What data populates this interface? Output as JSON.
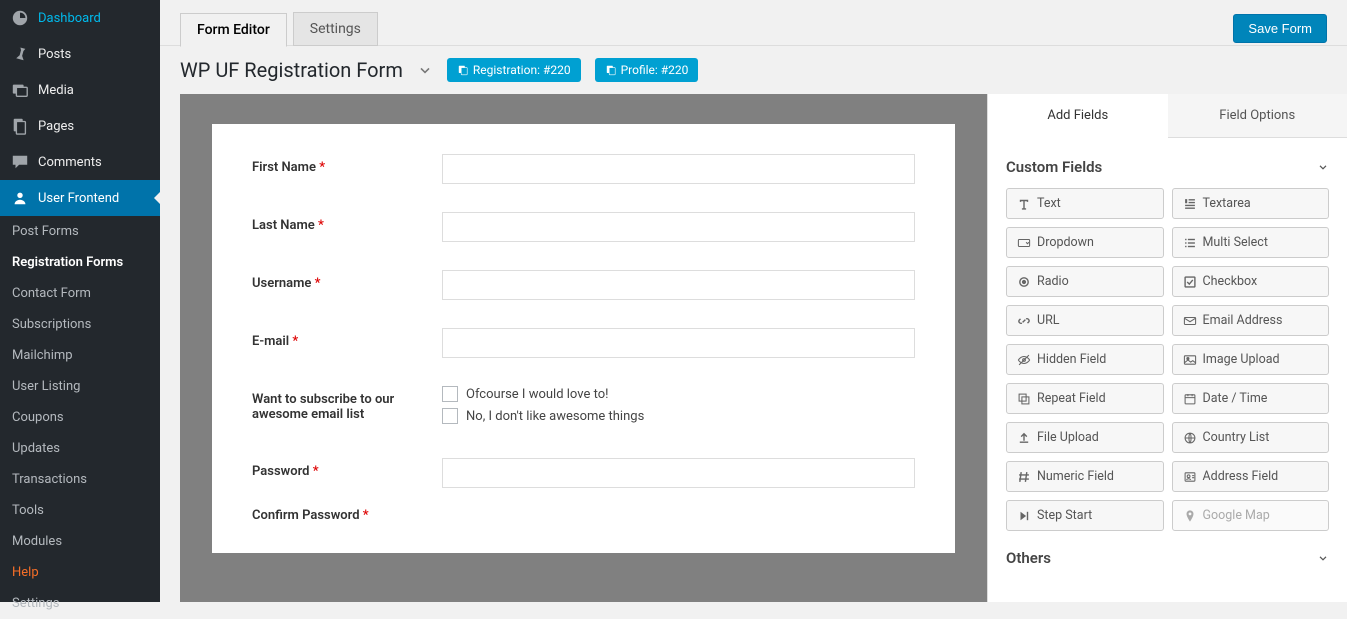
{
  "sidebar": {
    "items": [
      {
        "label": "Dashboard",
        "icon": "dashboard"
      },
      {
        "label": "Posts",
        "icon": "pin"
      },
      {
        "label": "Media",
        "icon": "media"
      },
      {
        "label": "Pages",
        "icon": "pages"
      },
      {
        "label": "Comments",
        "icon": "comments"
      },
      {
        "label": "User Frontend",
        "icon": "uf"
      }
    ],
    "sub": [
      {
        "label": "Post Forms"
      },
      {
        "label": "Registration Forms"
      },
      {
        "label": "Contact Form"
      },
      {
        "label": "Subscriptions"
      },
      {
        "label": "Mailchimp"
      },
      {
        "label": "User Listing"
      },
      {
        "label": "Coupons"
      },
      {
        "label": "Updates"
      },
      {
        "label": "Transactions"
      },
      {
        "label": "Tools"
      },
      {
        "label": "Modules"
      },
      {
        "label": "Help"
      },
      {
        "label": "Settings"
      }
    ]
  },
  "top": {
    "tab_editor": "Form Editor",
    "tab_settings": "Settings",
    "save": "Save Form"
  },
  "title": {
    "name": "WP UF Registration Form",
    "pill1": "Registration: #220",
    "pill2": "Profile: #220"
  },
  "form": {
    "first_name": "First Name",
    "last_name": "Last Name",
    "username": "Username",
    "email": "E-mail",
    "subscribe": "Want to subscribe to our awesome email list",
    "cb1": "Ofcourse I would love to!",
    "cb2": "No, I don't like awesome things",
    "password": "Password",
    "confirm": "Confirm Password"
  },
  "right": {
    "tab_add": "Add Fields",
    "tab_opts": "Field Options",
    "sec_custom": "Custom Fields",
    "sec_others": "Others",
    "fields": [
      {
        "label": "Text",
        "icon": "text"
      },
      {
        "label": "Textarea",
        "icon": "para"
      },
      {
        "label": "Dropdown",
        "icon": "dropdown"
      },
      {
        "label": "Multi Select",
        "icon": "list"
      },
      {
        "label": "Radio",
        "icon": "radio"
      },
      {
        "label": "Checkbox",
        "icon": "check"
      },
      {
        "label": "URL",
        "icon": "link"
      },
      {
        "label": "Email Address",
        "icon": "mail"
      },
      {
        "label": "Hidden Field",
        "icon": "eye-off"
      },
      {
        "label": "Image Upload",
        "icon": "image"
      },
      {
        "label": "Repeat Field",
        "icon": "repeat"
      },
      {
        "label": "Date / Time",
        "icon": "calendar"
      },
      {
        "label": "File Upload",
        "icon": "upload"
      },
      {
        "label": "Country List",
        "icon": "globe"
      },
      {
        "label": "Numeric Field",
        "icon": "hash"
      },
      {
        "label": "Address Field",
        "icon": "address"
      },
      {
        "label": "Step Start",
        "icon": "step"
      },
      {
        "label": "Google Map",
        "icon": "pin",
        "disabled": true
      }
    ]
  }
}
